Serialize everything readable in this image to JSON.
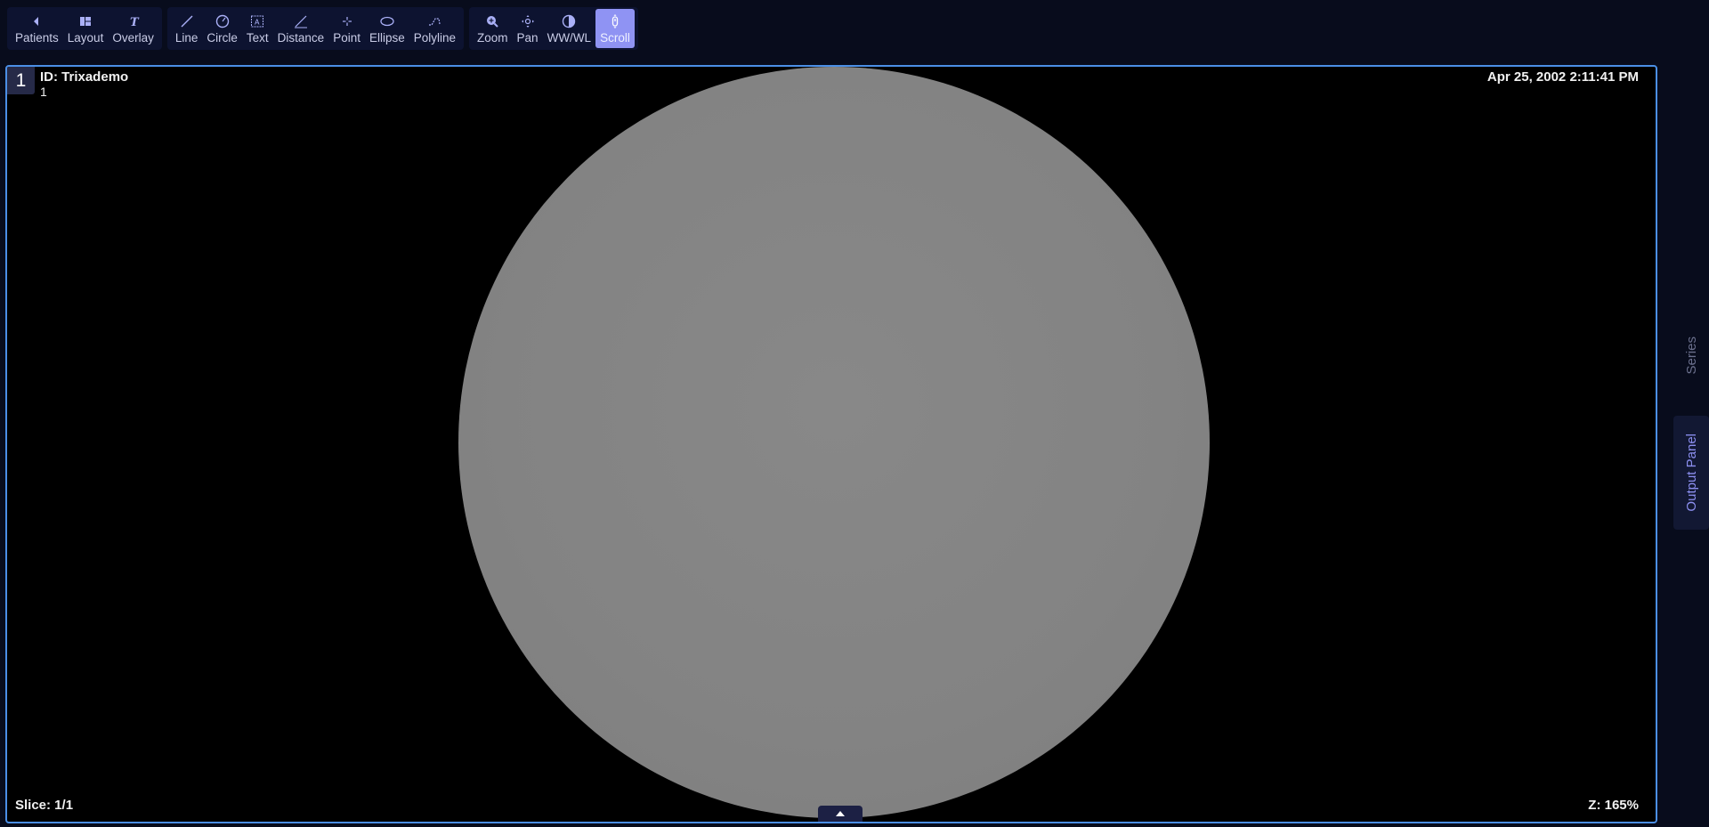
{
  "toolbar": {
    "groups": [
      [
        {
          "label": "Patients",
          "icon": "chevron-left-icon"
        },
        {
          "label": "Layout",
          "icon": "layout-grid-icon"
        },
        {
          "label": "Overlay",
          "icon": "text-overlay-icon"
        }
      ],
      [
        {
          "label": "Line",
          "icon": "line-icon"
        },
        {
          "label": "Circle",
          "icon": "circle-icon"
        },
        {
          "label": "Text",
          "icon": "text-box-icon"
        },
        {
          "label": "Distance",
          "icon": "distance-icon"
        },
        {
          "label": "Point",
          "icon": "point-icon"
        },
        {
          "label": "Ellipse",
          "icon": "ellipse-icon"
        },
        {
          "label": "Polyline",
          "icon": "polyline-icon"
        }
      ],
      [
        {
          "label": "Zoom",
          "icon": "zoom-icon"
        },
        {
          "label": "Pan",
          "icon": "pan-icon"
        },
        {
          "label": "WW/WL",
          "icon": "contrast-icon"
        },
        {
          "label": "Scroll",
          "icon": "scroll-icon",
          "active": true
        }
      ]
    ]
  },
  "viewport": {
    "index": "1",
    "patient_id": "ID: Trixademo",
    "series_number": "1",
    "datetime": "Apr 25, 2002 2:11:41 PM",
    "slice": "Slice: 1/1",
    "zoom": "Z: 165%"
  },
  "side_tabs": {
    "series": "Series",
    "output": "Output Panel"
  },
  "colors": {
    "accent": "#8f93f3",
    "viewport_border": "#4b8fe6",
    "background": "#080c1c"
  }
}
